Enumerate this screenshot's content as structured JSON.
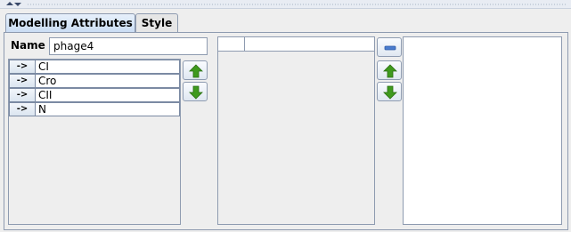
{
  "tabs": [
    {
      "label": "Modelling Attributes",
      "active": true
    },
    {
      "label": "Style",
      "active": false
    }
  ],
  "name_field": {
    "label": "Name",
    "value": "phage4"
  },
  "attributes": [
    {
      "button": "->",
      "label": "CI"
    },
    {
      "button": "->",
      "label": "Cro"
    },
    {
      "button": "->",
      "label": "CII"
    },
    {
      "button": "->",
      "label": "N"
    }
  ],
  "icons": {
    "move_up": "green-up-arrow-icon",
    "move_down": "green-down-arrow-icon",
    "remove": "minus-icon",
    "collapse_up": "chevron-up-icon",
    "collapse_down": "chevron-down-icon"
  },
  "colors": {
    "arrow_green": "#3f9a1e",
    "minus_blue": "#4a7ccf",
    "tab_active": "#c9dcf3"
  }
}
